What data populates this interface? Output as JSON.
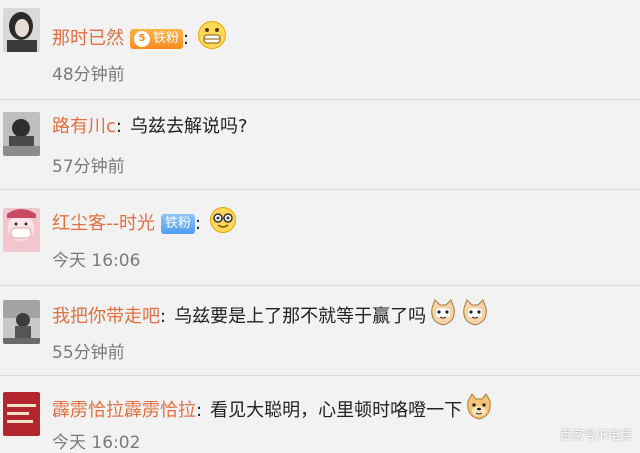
{
  "comments": [
    {
      "username": "那时已然",
      "badge": {
        "level": "5",
        "label": "铁粉",
        "color": "#ff8a1e"
      },
      "colon": ":",
      "text": "",
      "emojis": [
        "grinning-face"
      ],
      "time": "48分钟前"
    },
    {
      "username": "路有川c",
      "colon": ":",
      "text": "乌兹去解说吗?",
      "emojis": [],
      "time": "57分钟前"
    },
    {
      "username": "红尘客--时光",
      "badge": {
        "label": "铁粉",
        "color": "#4f9df0"
      },
      "colon": ":",
      "text": "",
      "emojis": [
        "nerd-face"
      ],
      "time": "今天 16:06"
    },
    {
      "username": "我把你带走吧",
      "colon": ":",
      "text": "乌兹要是上了那不就等于赢了吗",
      "emojis": [
        "cat-face",
        "cat-face"
      ],
      "time": "55分钟前"
    },
    {
      "username": "霹雳恰拉霹雳恰拉",
      "colon": ":",
      "text": "看见大聪明，心里顿时咯噔一下",
      "emojis": [
        "doge-face"
      ],
      "time": "今天 16:02"
    }
  ],
  "watermark": "百家号/R电竞"
}
